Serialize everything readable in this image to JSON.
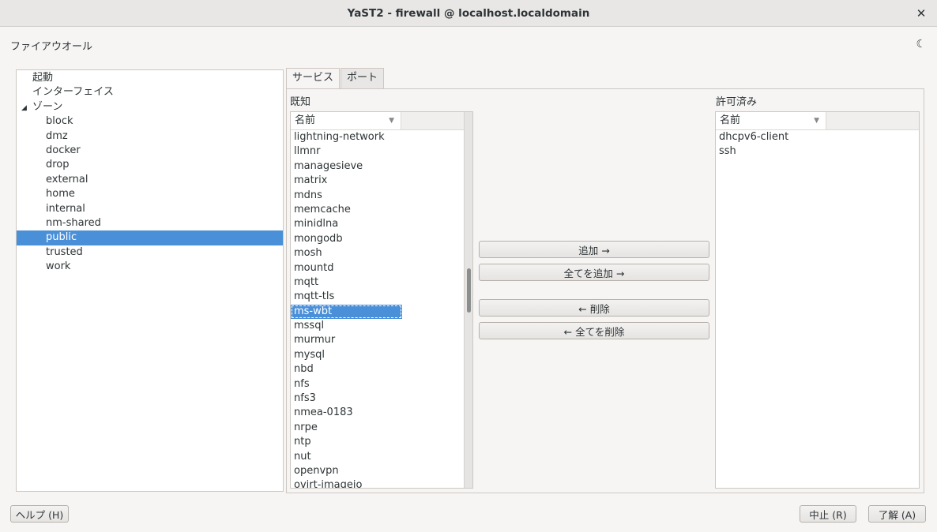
{
  "window": {
    "title": "YaST2 - firewall @ localhost.localdomain",
    "close_glyph": "✕"
  },
  "heading": "ファイアウオール",
  "theme_icon": "moon-icon",
  "tree": {
    "startup": "起動",
    "interfaces": "インターフェイス",
    "zones_label": "ゾーン",
    "zones": [
      "block",
      "dmz",
      "docker",
      "drop",
      "external",
      "home",
      "internal",
      "nm-shared",
      "public",
      "trusted",
      "work"
    ],
    "selected_zone": "public"
  },
  "tabs": {
    "services": "サービス",
    "ports": "ポート"
  },
  "known": {
    "label": "既知",
    "column": "名前",
    "items": [
      "lightning-network",
      "llmnr",
      "managesieve",
      "matrix",
      "mdns",
      "memcache",
      "minidlna",
      "mongodb",
      "mosh",
      "mountd",
      "mqtt",
      "mqtt-tls",
      "ms-wbt",
      "mssql",
      "murmur",
      "mysql",
      "nbd",
      "nfs",
      "nfs3",
      "nmea-0183",
      "nrpe",
      "ntp",
      "nut",
      "openvpn",
      "ovirt-imageio"
    ],
    "selected": "ms-wbt"
  },
  "allowed": {
    "label": "許可済み",
    "column": "名前",
    "items": [
      "dhcpv6-client",
      "ssh"
    ]
  },
  "buttons": {
    "add": "追加 →",
    "add_all": "全てを追加 →",
    "remove": "← 削除",
    "remove_all": "← 全てを削除",
    "help": "ヘルプ (H)",
    "cancel": "中止 (R)",
    "ok": "了解 (A)"
  },
  "colors": {
    "selection": "#4a90d9",
    "background": "#f6f5f4"
  }
}
